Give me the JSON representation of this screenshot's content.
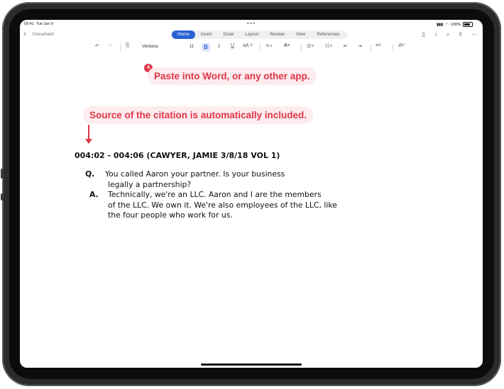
{
  "status": {
    "time": "09:41",
    "date": "Tue Jan 9",
    "battery": "100%"
  },
  "header": {
    "back_label": "Document"
  },
  "tabs": [
    {
      "label": "Home",
      "active": true
    },
    {
      "label": "Insert"
    },
    {
      "label": "Draw"
    },
    {
      "label": "Layout"
    },
    {
      "label": "Review"
    },
    {
      "label": "View"
    },
    {
      "label": "References"
    }
  ],
  "toolbar": {
    "font_name": "Verdana",
    "font_size": "11",
    "bold": "B",
    "italic": "I",
    "underline": "U",
    "font_size_menu": "aA"
  },
  "callouts": {
    "step_number": "4",
    "paste": "Paste into Word, or any other app.",
    "source": "Source of the citation is automatically included."
  },
  "document": {
    "citation": "004:02 - 004:06 (CAWYER, JAMIE 3/8/18 VOL 1)",
    "q_label": "Q.",
    "q_lines": [
      "You called Aaron your partner.  Is your business",
      "legally a partnership?"
    ],
    "a_label": "A.",
    "a_lines": [
      "Technically, we're an LLC.  Aaron and I are the members",
      "of the LLC.  We own it.  We're also employees of the LLC, like",
      "the four people who work for us."
    ]
  },
  "colors": {
    "accent": "#2a62d4",
    "callout_red": "#e0364a",
    "callout_bg": "#fdecee"
  }
}
